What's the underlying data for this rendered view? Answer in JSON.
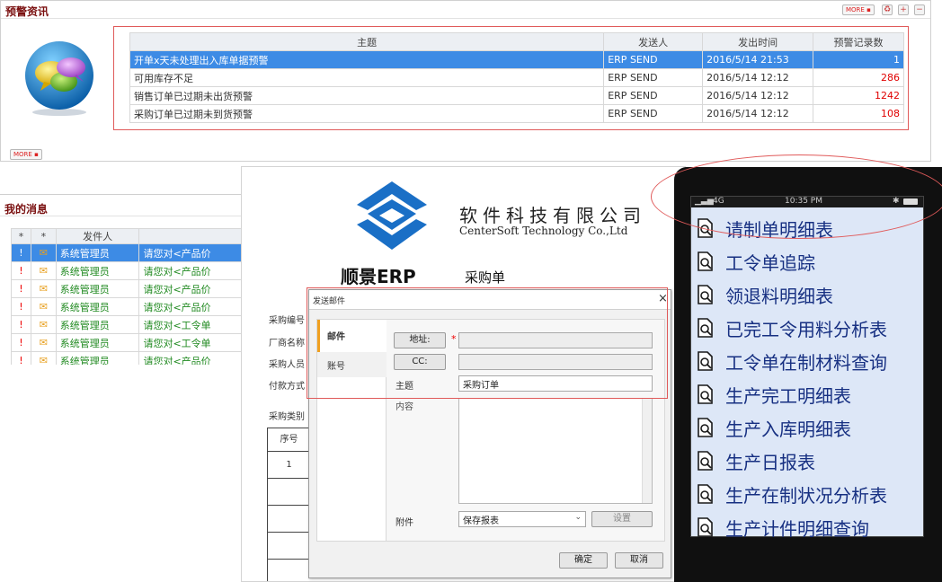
{
  "warning": {
    "title": "预警资讯",
    "more": "MORE",
    "columns": [
      "主题",
      "发送人",
      "发出时间",
      "预警记录数"
    ],
    "rows": [
      {
        "subject": "开单x天未处理出入库单据预警",
        "sender": "ERP SEND",
        "time": "2016/5/14 21:53",
        "count": "1"
      },
      {
        "subject": "可用库存不足",
        "sender": "ERP SEND",
        "time": "2016/5/14 12:12",
        "count": "286"
      },
      {
        "subject": "销售订单已过期未出货预警",
        "sender": "ERP SEND",
        "time": "2016/5/14 12:12",
        "count": "1242"
      },
      {
        "subject": "采购订单已过期未到货预警",
        "sender": "ERP SEND",
        "time": "2016/5/14 12:12",
        "count": "108"
      }
    ],
    "more_bottom": "MORE"
  },
  "messages": {
    "title": "我的消息",
    "columns": [
      "*",
      "*",
      "发件人",
      ""
    ],
    "rows": [
      {
        "flag": "!",
        "sender": "系统管理员",
        "content": "请您对<产品价"
      },
      {
        "flag": "!",
        "sender": "系统管理员",
        "content": "请您对<产品价"
      },
      {
        "flag": "!",
        "sender": "系统管理员",
        "content": "请您对<产品价"
      },
      {
        "flag": "!",
        "sender": "系统管理员",
        "content": "请您对<产品价"
      },
      {
        "flag": "!",
        "sender": "系统管理员",
        "content": "请您对<工令单"
      },
      {
        "flag": "!",
        "sender": "系统管理员",
        "content": "请您对<工令单"
      },
      {
        "flag": "!",
        "sender": "系统管理员",
        "content": "请您对<产品价"
      }
    ]
  },
  "document": {
    "company_cn": "软件科技有限公司",
    "company_en": "CenterSoft Technology Co.,Ltd",
    "erp_brand": "顺景ERP",
    "doc_title": "采购单",
    "labels": [
      "采购编号",
      "厂商名称",
      "采购人员",
      "付款方式",
      "采购类别"
    ],
    "table_header": "序号",
    "first_row": "1"
  },
  "dialog": {
    "title": "发送邮件",
    "close": "×",
    "tabs": [
      "邮件",
      "账号"
    ],
    "address_btn": "地址:",
    "required_mark": "*",
    "cc_btn": "CC:",
    "subject_label": "主题",
    "subject_value": "采购订单",
    "content_label": "内容",
    "attachment_label": "附件",
    "attachment_value": "保存报表",
    "settings_btn": "设置",
    "ok_btn": "确定",
    "cancel_btn": "取消"
  },
  "phone": {
    "signal": "4G",
    "time": "10:35 PM",
    "menu": [
      "请制单明细表",
      "工令单追踪",
      "领退料明细表",
      "已完工令用料分析表",
      "工令单在制材料查询",
      "生产完工明细表",
      "生产入库明细表",
      "生产日报表",
      "生产在制状况分析表",
      "生产计件明细查询"
    ]
  },
  "colors": {
    "selection": "#3d8be5",
    "frame": "#e05a5a",
    "count_red": "#e00000",
    "menu_text": "#173082"
  }
}
